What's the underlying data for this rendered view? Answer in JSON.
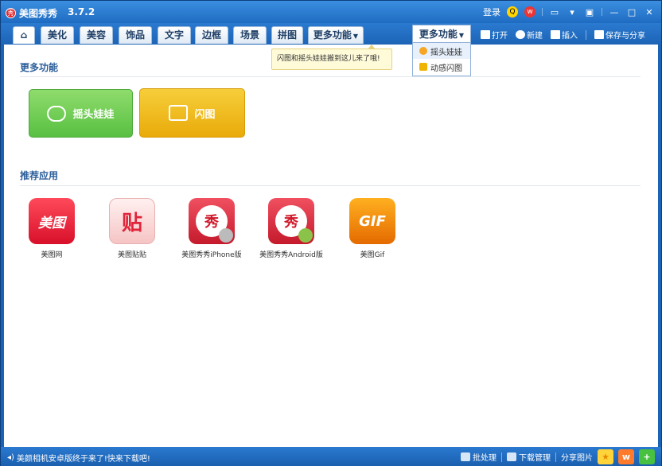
{
  "titlebar": {
    "logo_glyph": "秀",
    "title": "美图秀秀",
    "version": "3.7.2",
    "login": "登录",
    "icons": [
      "qq-icon",
      "weibo-icon",
      "skin-icon",
      "feedback-icon",
      "mini-icon",
      "minimize-icon",
      "maximize-icon",
      "close-icon"
    ]
  },
  "tabs": [
    {
      "label": "⌂"
    },
    {
      "label": "美化"
    },
    {
      "label": "美容"
    },
    {
      "label": "饰品"
    },
    {
      "label": "文字"
    },
    {
      "label": "边框"
    },
    {
      "label": "场景"
    },
    {
      "label": "拼图"
    },
    {
      "label": "更多功能"
    }
  ],
  "more_menu": {
    "label": "更多功能",
    "items": [
      {
        "label": "摇头娃娃"
      },
      {
        "label": "动感闪图"
      }
    ]
  },
  "tools": [
    {
      "label": "打开"
    },
    {
      "label": "新建"
    },
    {
      "label": "插入"
    },
    {
      "label": "保存与分享"
    }
  ],
  "tooltip": "闪图和摇头娃娃搬到这儿来了哦!",
  "sections": {
    "more": {
      "title": "更多功能",
      "buttons": [
        {
          "label": "摇头娃娃",
          "color": "#62c348"
        },
        {
          "label": "闪图",
          "color": "#f0b416"
        }
      ]
    },
    "apps": {
      "title": "推荐应用",
      "items": [
        {
          "label": "美图网",
          "glyph": "美图"
        },
        {
          "label": "美图贴贴",
          "glyph": "贴"
        },
        {
          "label": "美图秀秀iPhone版",
          "glyph": "秀"
        },
        {
          "label": "美图秀秀Android版",
          "glyph": "秀"
        },
        {
          "label": "美图Gif",
          "glyph": "GIF"
        }
      ]
    }
  },
  "statusbar": {
    "message": "美颜相机安卓版终于来了!快来下载吧!",
    "batch": "批处理",
    "download": "下载管理",
    "share": "分享图片"
  },
  "colors": {
    "frame": "#1b63b4",
    "accent": "#2a5d99"
  }
}
